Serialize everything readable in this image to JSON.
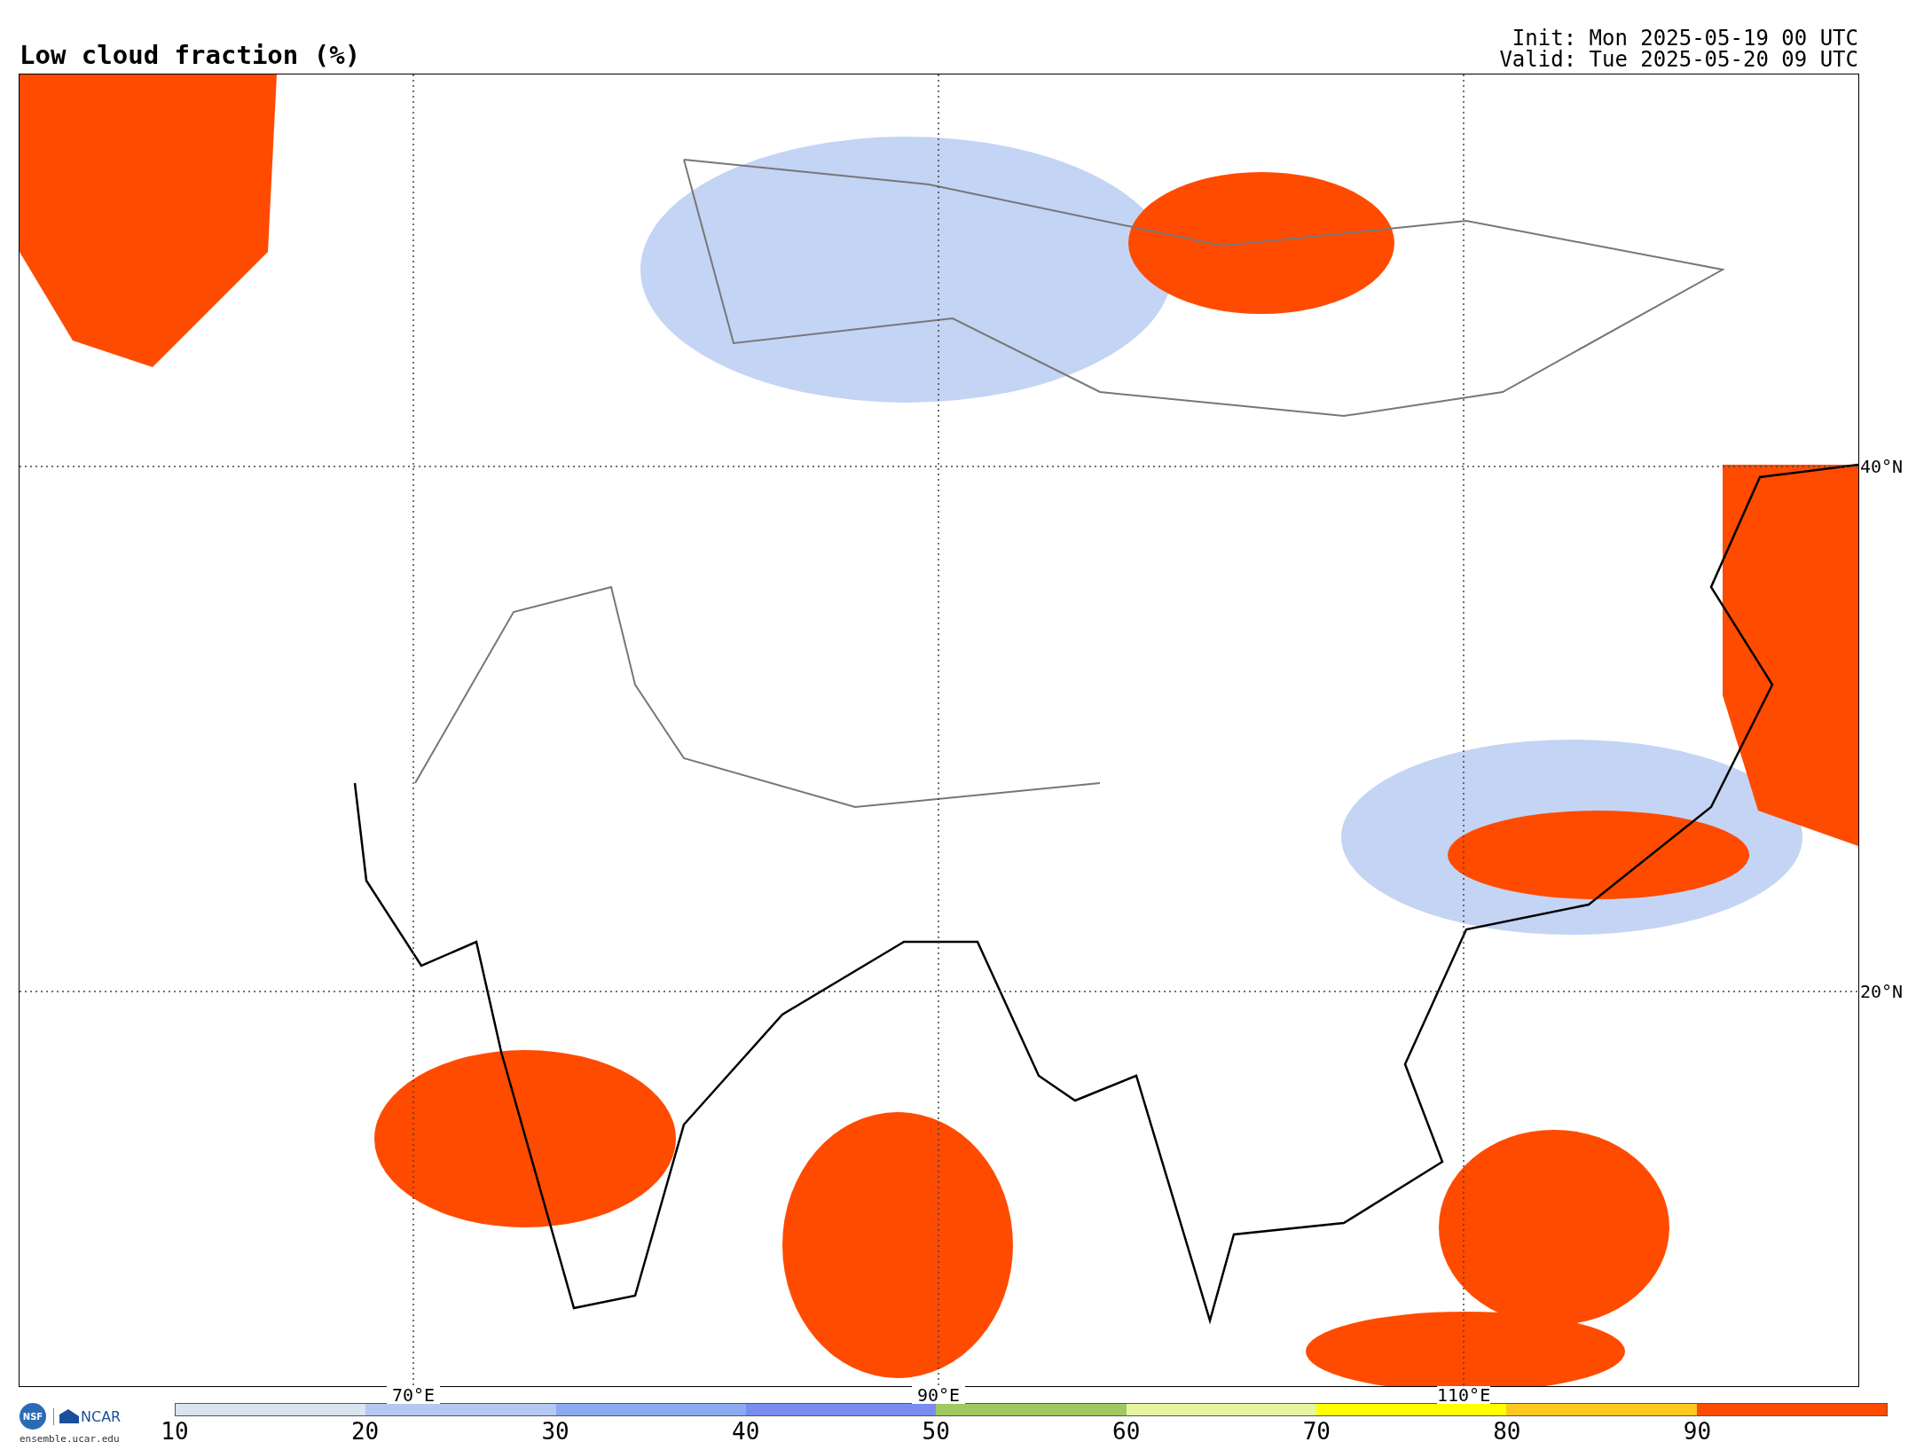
{
  "title": "Low cloud fraction (%)",
  "init": "Init: Mon 2025-05-19 00 UTC",
  "valid": "Valid: Tue 2025-05-20 09 UTC",
  "map": {
    "lon_labels": [
      "70°E",
      "90°E",
      "110°E"
    ],
    "lat_labels": [
      "40°N",
      "20°N"
    ]
  },
  "logos": {
    "nsf": "NSF",
    "ncar": "NCAR",
    "url": "ensemble.ucar.edu"
  },
  "colorbar": {
    "bins": [
      {
        "color": "#d9e4ee"
      },
      {
        "color": "#b4c8f0"
      },
      {
        "color": "#8caaf0"
      },
      {
        "color": "#7a8cf0"
      },
      {
        "color": "#a0c860"
      },
      {
        "color": "#e6f5a0"
      },
      {
        "color": "#ffff00"
      },
      {
        "color": "#ffc820"
      },
      {
        "color": "#ff4b00"
      }
    ],
    "ticks": [
      "10",
      "20",
      "30",
      "40",
      "50",
      "60",
      "70",
      "80",
      "90"
    ]
  }
}
